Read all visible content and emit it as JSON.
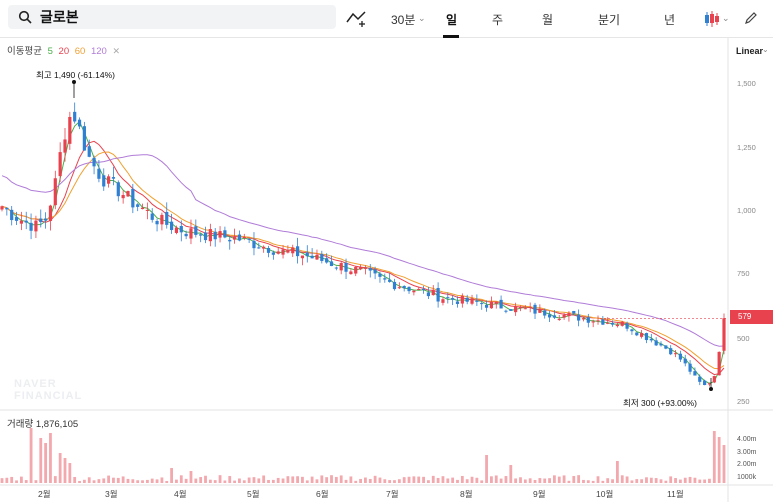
{
  "search": {
    "value": "글로본"
  },
  "toolbar": {
    "interval": "30분",
    "tabs": [
      "일",
      "주",
      "월",
      "분기",
      "년"
    ],
    "active_tab": "일",
    "icons": [
      "line-chart-add-icon",
      "candlestick-icon",
      "pencil-icon"
    ]
  },
  "ma_legend": {
    "title": "이동평균",
    "periods": [
      "5",
      "20",
      "60",
      "120"
    ],
    "colors": [
      "#4cae4c",
      "#e8424e",
      "#f0a030",
      "#b07cd8"
    ]
  },
  "scale": "Linear",
  "price_axis": [
    "1,500",
    "1,250",
    "1,000",
    "750",
    "500",
    "250"
  ],
  "current_price": "579",
  "annotations": {
    "high": "최고 1,490 (-61.14%)",
    "low": "최저 300 (+93.00%)"
  },
  "watermark": [
    "NAVER",
    "FINANCIAL"
  ],
  "volume": {
    "label": "거래량",
    "value": "1,876,105",
    "axis": [
      "4.00m",
      "3.00m",
      "2.00m",
      "1000k"
    ]
  },
  "months": [
    "2월",
    "3월",
    "4월",
    "5월",
    "6월",
    "7월",
    "8월",
    "9월",
    "10월",
    "11월"
  ],
  "chart_data": {
    "type": "candlestick",
    "scale": "linear",
    "ylim": [
      250,
      1500
    ],
    "colors": {
      "up": "#e8424e",
      "down": "#2f7fd3",
      "volume": "#f2a8ad"
    },
    "close_path": [
      1020,
      990,
      970,
      950,
      940,
      970,
      1100,
      1300,
      1400,
      1300,
      1200,
      1150,
      1110,
      1090,
      1060,
      1030,
      1010,
      980,
      960,
      945,
      930,
      920,
      915,
      910,
      905,
      900,
      895,
      890,
      880,
      870,
      860,
      850,
      840,
      835,
      830,
      820,
      810,
      800,
      790,
      780,
      770,
      760,
      745,
      730,
      720,
      710,
      700,
      690,
      680,
      670,
      660,
      655,
      650,
      645,
      640,
      635,
      630,
      625,
      620,
      615,
      610,
      605,
      600,
      595,
      590,
      585,
      580,
      575,
      570,
      565,
      560,
      550,
      530,
      510,
      490,
      470,
      450,
      420,
      380,
      330,
      310,
      360,
      579
    ],
    "ma": [
      {
        "period": "5",
        "color": "#4cae4c"
      },
      {
        "period": "20",
        "color": "#e8424e"
      },
      {
        "period": "60",
        "color": "#f0a030"
      },
      {
        "period": "120",
        "color": "#b07cd8"
      }
    ],
    "high": 1490,
    "low": 300,
    "last": 579
  }
}
